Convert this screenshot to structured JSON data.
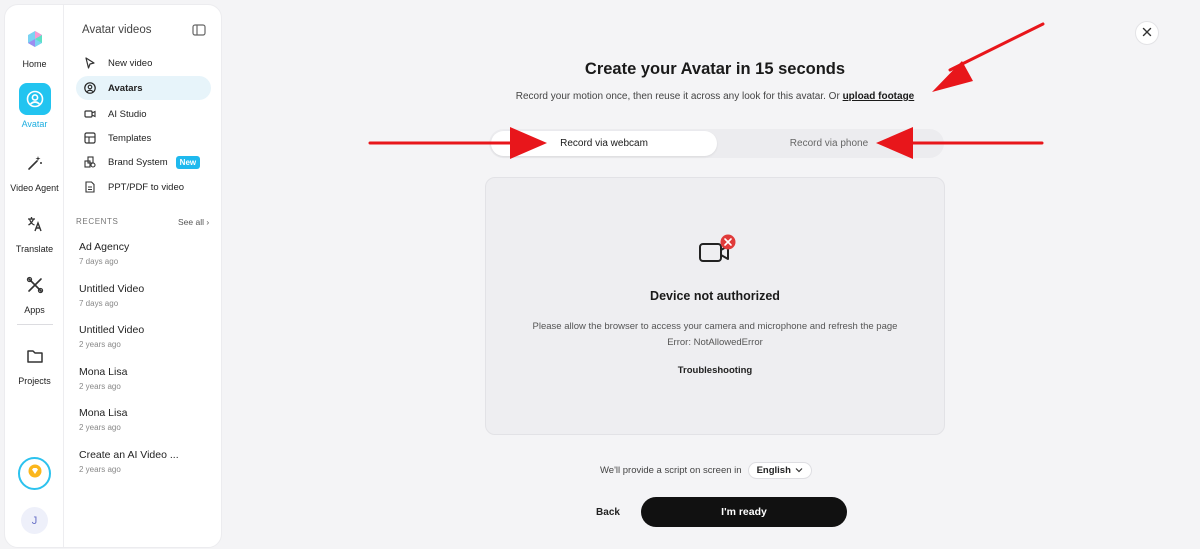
{
  "sidebar": {
    "rail": [
      {
        "label": "Home",
        "icon": "logo-icon"
      },
      {
        "label": "Avatar",
        "icon": "avatar-icon",
        "active": true
      },
      {
        "label": "Video Agent",
        "icon": "magic-wand-icon"
      },
      {
        "label": "Translate",
        "icon": "translate-icon"
      },
      {
        "label": "Apps",
        "icon": "apps-icon"
      },
      {
        "label": "Projects",
        "icon": "folder-icon"
      }
    ],
    "user_initial": "J",
    "panel_title": "Avatar videos",
    "nav": [
      {
        "label": "New video",
        "icon": "cursor-icon"
      },
      {
        "label": "Avatars",
        "icon": "avatar-circle-icon",
        "active": true
      },
      {
        "label": "AI Studio",
        "icon": "video-camera-icon"
      },
      {
        "label": "Templates",
        "icon": "templates-icon"
      },
      {
        "label": "Brand System",
        "icon": "brand-icon",
        "badge": "New"
      },
      {
        "label": "PPT/PDF to video",
        "icon": "document-icon"
      }
    ],
    "recents_heading": "RECENTS",
    "see_all": "See all ›",
    "recents": [
      {
        "title": "Ad Agency",
        "date": "7 days ago"
      },
      {
        "title": "Untitled Video",
        "date": "7 days ago"
      },
      {
        "title": "Untitled Video",
        "date": "2 years ago"
      },
      {
        "title": "Mona Lisa",
        "date": "2 years ago"
      },
      {
        "title": "Mona Lisa",
        "date": "2 years ago"
      },
      {
        "title": "Create an AI Video ...",
        "date": "2 years ago"
      }
    ]
  },
  "main": {
    "title": "Create your Avatar in 15 seconds",
    "subtitle": "Record your motion once, then reuse it across any look for this avatar. Or ",
    "upload_link": "upload footage",
    "tabs": [
      {
        "label": "Record via webcam",
        "selected": true
      },
      {
        "label": "Record via phone",
        "selected": false
      }
    ],
    "card": {
      "heading": "Device not authorized",
      "message": "Please allow the browser to access your camera and microphone and refresh the page",
      "error": "Error: NotAllowedError",
      "troubleshooting": "Troubleshooting"
    },
    "script_text": "We'll provide a script on screen in",
    "language": "English",
    "back_label": "Back",
    "ready_label": "I'm ready"
  },
  "colors": {
    "accent": "#22c4f0",
    "error": "#e03a3a",
    "annotation_arrow": "#e8161b",
    "primary_button": "#111111"
  }
}
